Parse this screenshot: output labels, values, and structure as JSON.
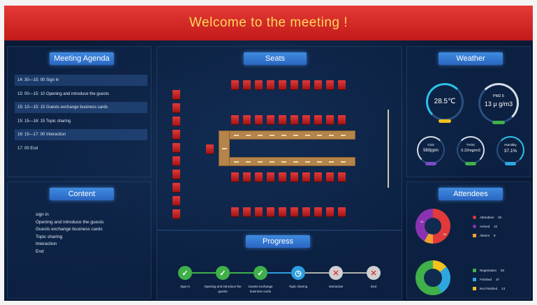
{
  "banner": {
    "title": "Welcome to the meeting !"
  },
  "agenda": {
    "title": "Meeting Agenda",
    "items": [
      "14: 30—15: 00  Sign in",
      "15: 00—15: 10  Opening and introduce the guests",
      "15: 10—15: 15  Guests exchange business cards",
      "15: 15—16: 15  Topic sharing",
      "16: 15—17: 00  Interaction",
      "17: 00  End"
    ]
  },
  "content": {
    "title": "Content",
    "items": [
      "sign in",
      "Opening and introduce the guests",
      "Guests exchange business cards",
      "Topic sharing",
      "Interaction",
      "End"
    ]
  },
  "seats": {
    "title": "Seats"
  },
  "progress": {
    "title": "Progress",
    "steps": [
      {
        "label": "Sign in",
        "status": "done"
      },
      {
        "label": "Opening and introduce the guests",
        "status": "done"
      },
      {
        "label": "Guests exchange business cards",
        "status": "done"
      },
      {
        "label": "Topic sharing",
        "status": "current"
      },
      {
        "label": "Interactive",
        "status": "pending"
      },
      {
        "label": "End",
        "status": "pending"
      }
    ],
    "colors": {
      "done": "#3fb04a",
      "current": "#2e9ee0",
      "pending": "#b0b0b0"
    }
  },
  "weather": {
    "title": "Weather",
    "temperature": {
      "value": "28.5℃",
      "color": "#f3c21c"
    },
    "pm25": {
      "label": "PM2.5",
      "value": "13 μ g/m3",
      "color": "#3fb04a"
    },
    "co2": {
      "label": "CO2",
      "value": "560ppm",
      "color": "#7a4cc8"
    },
    "tvoc": {
      "label": "TVOC",
      "value": "0.22mg/m3",
      "color": "#3fb04a"
    },
    "humidity": {
      "label": "Humidity",
      "value": "37.1%",
      "color": "#2ea7e0"
    }
  },
  "attendees": {
    "title": "Attendees",
    "chart1": {
      "legend": [
        {
          "label": "Attendees",
          "value": "50",
          "color": "#e23a3a"
        },
        {
          "label": "Arrived",
          "value": "42",
          "color": "#8a33b0"
        },
        {
          "label": "Absent",
          "value": "8",
          "color": "#f0a030"
        }
      ],
      "slice_labels": [
        "42",
        "50"
      ]
    },
    "chart2": {
      "legend": [
        {
          "label": "Registration",
          "value": "50",
          "color": "#3fb04a"
        },
        {
          "label": "Finished",
          "value": "37",
          "color": "#2ea7e0"
        },
        {
          "label": "Not Finished",
          "value": "13",
          "color": "#f3c21c"
        }
      ]
    }
  }
}
